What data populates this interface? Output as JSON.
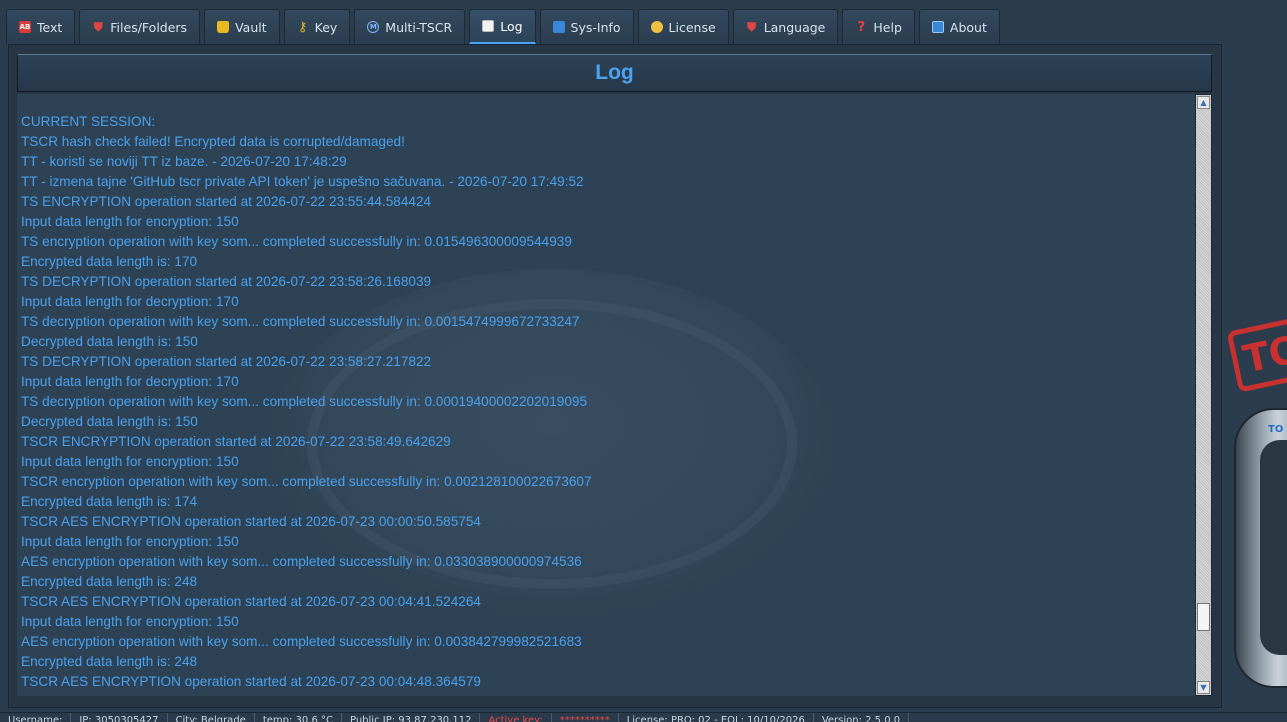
{
  "tabs": [
    {
      "label": "Text",
      "icon": "text-icon",
      "active": false
    },
    {
      "label": "Files/Folders",
      "icon": "shield-icon",
      "active": false
    },
    {
      "label": "Vault",
      "icon": "lock-icon",
      "active": false
    },
    {
      "label": "Key",
      "icon": "key-icon",
      "active": false
    },
    {
      "label": "Multi-TSCR",
      "icon": "m-circle-icon",
      "active": false
    },
    {
      "label": "Log",
      "icon": "document-icon",
      "active": true
    },
    {
      "label": "Sys-Info",
      "icon": "system-info-icon",
      "active": false
    },
    {
      "label": "License",
      "icon": "license-medal-icon",
      "active": false
    },
    {
      "label": "Language",
      "icon": "shield-icon",
      "active": false
    },
    {
      "label": "Help",
      "icon": "question-icon",
      "active": false
    },
    {
      "label": "About",
      "icon": "window-icon",
      "active": false
    }
  ],
  "log": {
    "title": "Log",
    "lines": [
      "CURRENT SESSION:",
      "TSCR hash check failed! Encrypted data is corrupted/damaged!",
      "TT - koristi se noviji TT iz baze. - 2026-07-20 17:48:29",
      "TT - izmena tajne 'GitHub tscr private API token' je uspešno sačuvana. - 2026-07-20 17:49:52",
      "TS ENCRYPTION operation started at 2026-07-22 23:55:44.584424",
      "Input data length for encryption: 150",
      "TS encryption operation with key som... completed successfully in: 0.015496300009544939",
      "Encrypted data length is: 170",
      "TS DECRYPTION operation started at 2026-07-22 23:58:26.168039",
      "Input data length for decryption: 170",
      "TS decryption operation with key som... completed successfully in: 0.0015474999672733247",
      "Decrypted data length is: 150",
      "TS DECRYPTION operation started at 2026-07-22 23:58:27.217822",
      "Input data length for decryption: 170",
      "TS decryption operation with key som... completed successfully in: 0.00019400002202019095",
      "Decrypted data length is: 150",
      "TSCR ENCRYPTION operation started at 2026-07-22 23:58:49.642629",
      "Input data length for encryption: 150",
      "TSCR encryption operation with key som... completed successfully in: 0.002128100022673607",
      "Encrypted data length is: 174",
      "TSCR AES ENCRYPTION operation started at 2026-07-23 00:00:50.585754",
      "Input data length for encryption: 150",
      "AES encryption operation with key som... completed successfully in: 0.033038900000974536",
      "Encrypted data length is: 248",
      "TSCR AES ENCRYPTION operation started at 2026-07-23 00:04:41.524264",
      "Input data length for encryption: 150",
      "AES encryption operation with key som... completed successfully in: 0.003842799982521683",
      "Encrypted data length is: 248",
      "TSCR AES ENCRYPTION operation started at 2026-07-23 00:04:48.364579"
    ]
  },
  "colors": {
    "log_text": "#4aa0ec",
    "title": "#4ea3f0",
    "background": "#2b3c4d",
    "active_tab_accent": "#4aa3ff"
  },
  "decoration": {
    "stamp_text": "TO",
    "device_label": "TO"
  },
  "statusbar": [
    {
      "text": "Username:",
      "red": false
    },
    {
      "text": "IP: 3050305427",
      "red": false
    },
    {
      "text": "City: Belgrade",
      "red": false
    },
    {
      "text": "temp: 30.6 °C",
      "red": false
    },
    {
      "text": "Public IP: 93.87.230.112",
      "red": false
    },
    {
      "text": "Active key:",
      "red": true
    },
    {
      "text": "**********",
      "red": true
    },
    {
      "text": "License: PRO: 02 - EOL: 10/10/2026",
      "red": false
    },
    {
      "text": "Version: 2.5.0.0",
      "red": false
    }
  ]
}
